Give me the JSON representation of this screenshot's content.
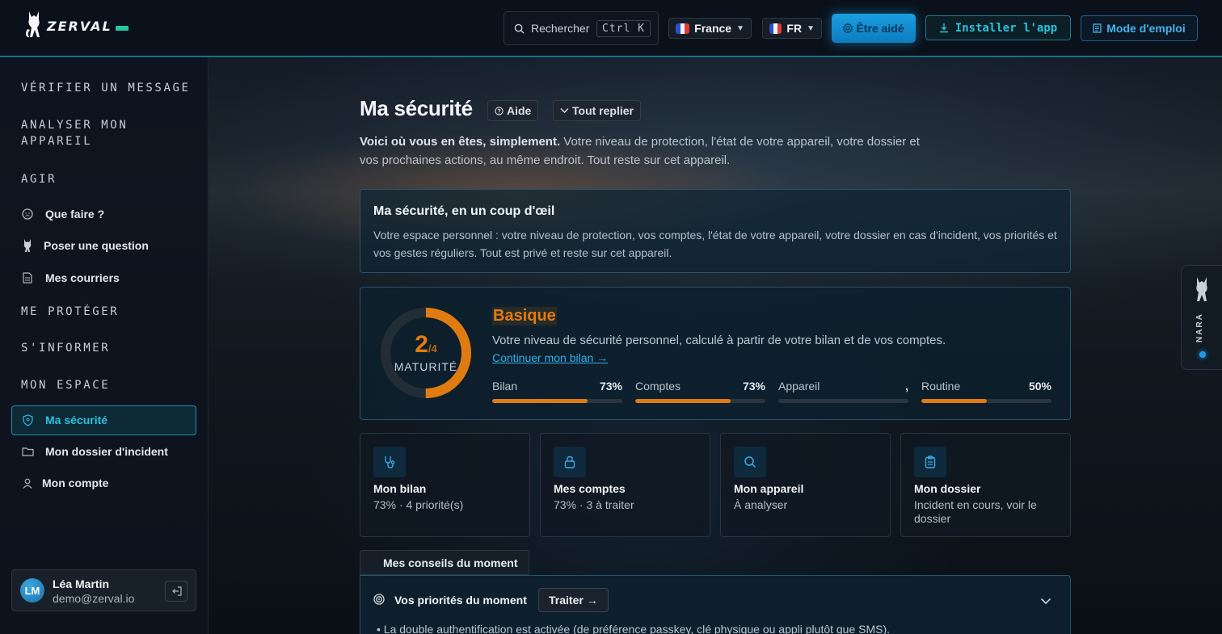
{
  "header": {
    "logo_text": "ZERVAL",
    "search": {
      "label": "Rechercher",
      "shortcut": "Ctrl K"
    },
    "country": {
      "label": "France"
    },
    "language": {
      "label": "FR"
    },
    "help_button": "Être aidé",
    "install_button": "Installer l'app",
    "guide_button": "Mode d'emploi"
  },
  "sidebar": {
    "sections": {
      "verify": "VÉRIFIER UN MESSAGE",
      "analyze_line1": "ANALYSER MON",
      "analyze_line2": "APPAREIL",
      "act": "AGIR",
      "protect": "ME PROTÉGER",
      "inform": "S'INFORMER",
      "space": "MON ESPACE"
    },
    "items": {
      "what_to_do": "Que faire ?",
      "ask_question": "Poser une question",
      "letters": "Mes courriers",
      "my_security": "Ma sécurité",
      "incident_file": "Mon dossier d'incident",
      "account": "Mon compte"
    },
    "user": {
      "initials": "LM",
      "name": "Léa Martin",
      "email": "demo@zerval.io"
    }
  },
  "main": {
    "title": "Ma sécurité",
    "help_chip": "Aide",
    "collapse_chip": "Tout replier",
    "intro_bold": "Voici où vous en êtes, simplement.",
    "intro_rest": " Votre niveau de protection, l'état de votre appareil, votre dossier et vos prochaines actions, au même endroit. Tout reste sur cet appareil.",
    "overview": {
      "title": "Ma sécurité, en un coup d'œil",
      "text": "Votre espace personnel : votre niveau de protection, vos comptes, l'état de votre appareil, votre dossier en cas d'incident, vos priorités et vos gestes réguliers. Tout est privé et reste sur cet appareil."
    },
    "maturity": {
      "score": "2",
      "max": "/4",
      "score_fraction": 0.5,
      "label": "MATURITÉ",
      "level": "Basique",
      "description": "Votre niveau de sécurité personnel, calculé à partir de votre bilan et de vos comptes.",
      "link": "Continuer mon bilan →",
      "bars": [
        {
          "label": "Bilan",
          "value": "73%",
          "fraction": 0.73
        },
        {
          "label": "Comptes",
          "value": "73%",
          "fraction": 0.73
        },
        {
          "label": "Appareil",
          "value": ",",
          "fraction": 0
        },
        {
          "label": "Routine",
          "value": "50%",
          "fraction": 0.5
        }
      ]
    },
    "tiles": [
      {
        "title": "Mon bilan",
        "subtitle": "73% · 4 priorité(s)",
        "icon": "stethoscope-icon"
      },
      {
        "title": "Mes comptes",
        "subtitle": "73% · 3 à traiter",
        "icon": "lock-icon"
      },
      {
        "title": "Mon appareil",
        "subtitle": "À analyser",
        "icon": "search-icon"
      },
      {
        "title": "Mon dossier",
        "subtitle": "Incident en cours, voir le dossier",
        "icon": "clipboard-icon"
      }
    ],
    "tips_tab": "Mes conseils du moment",
    "priorities": {
      "title": "Vos priorités du moment",
      "button": "Traiter →",
      "first_item": "La double authentification est activée (de préférence passkey, clé physique ou appli plutôt que SMS)."
    }
  },
  "assistant": {
    "label": "NARA"
  },
  "colors": {
    "accent": "#1f9be6",
    "warning": "#e07b12",
    "teal": "#27c4d8"
  }
}
